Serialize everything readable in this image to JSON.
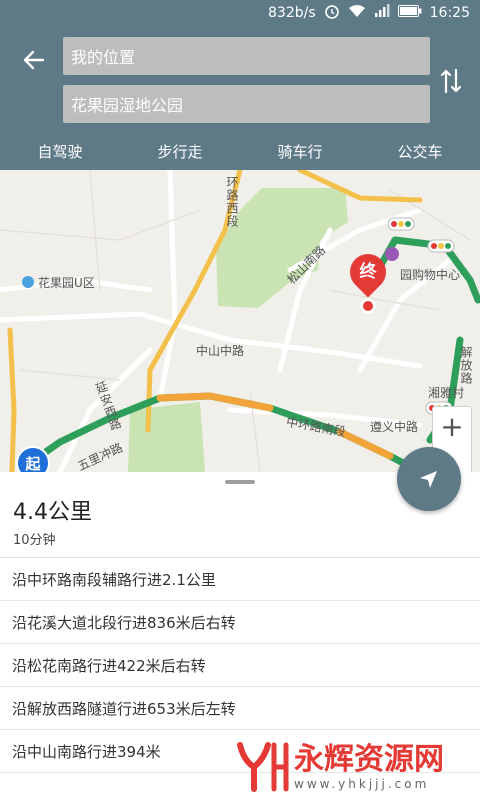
{
  "status_bar": {
    "speed": "832b/s",
    "time": "16:25"
  },
  "search": {
    "start": "我的位置",
    "end": "花果园湿地公园"
  },
  "modes": [
    "自驾驶",
    "步行走",
    "骑车行",
    "公交车"
  ],
  "map": {
    "labels": {
      "ring_west": "环路西段",
      "songshan": "松山南路",
      "guoyuan": "花果园U区",
      "zhongshan": "中山中路",
      "mall": "园购物中心",
      "yanan": "延安西路",
      "ring_south": "中环路南段",
      "zunyi": "遵义中路",
      "wuli": "五里冲路",
      "xiangya": "湘雅村",
      "jiefang": "解放路"
    },
    "start_marker": "起",
    "end_marker": "终",
    "zoom_in": "+"
  },
  "route": {
    "distance": "4.4公里",
    "duration": "10分钟",
    "steps": [
      "沿中环路南段辅路行进2.1公里",
      "沿花溪大道北段行进836米后右转",
      "沿松花南路行进422米后右转",
      "沿解放西路隧道行进653米后左转",
      "沿中山南路行进394米"
    ]
  },
  "watermark": {
    "title": "永辉资源网",
    "url": "www.yhkjjj.com"
  },
  "colors": {
    "header": "#5f7a87",
    "route_green": "#2e9e5b",
    "marker_red": "#e53935",
    "start_blue": "#1e6fd9"
  }
}
